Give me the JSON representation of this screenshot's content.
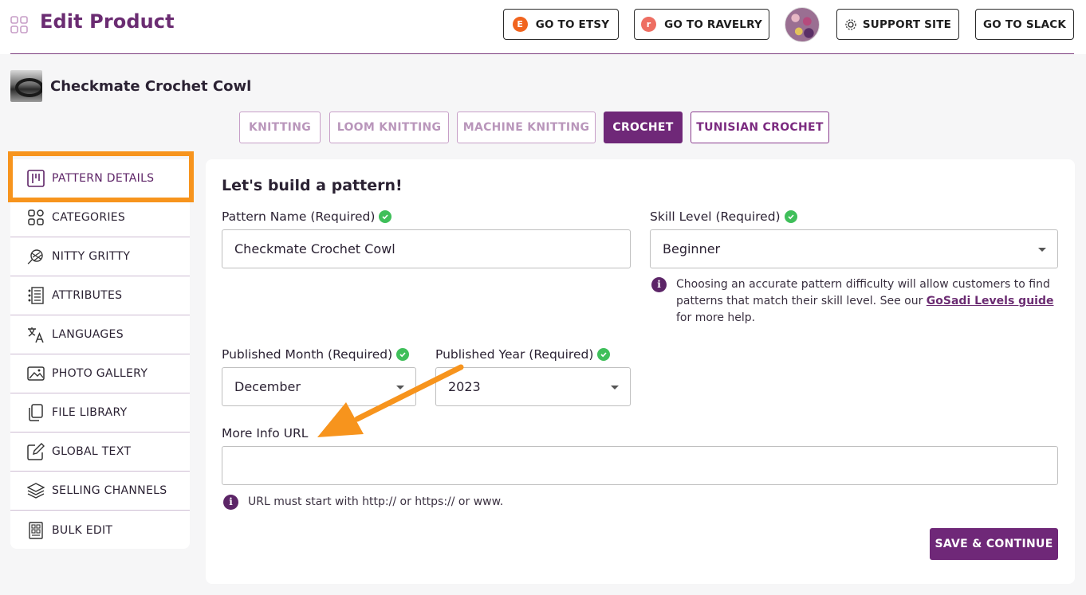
{
  "header": {
    "title": "Edit Product",
    "buttons": {
      "etsy": "GO TO ETSY",
      "ravelry": "GO TO RAVELRY",
      "support": "SUPPORT SITE",
      "slack": "GO TO SLACK"
    },
    "etsy_glyph": "E",
    "ravelry_glyph": "r",
    "etsy_color": "#f1641e",
    "ravelry_color": "#ee6e62"
  },
  "product": {
    "name": "Checkmate Crochet Cowl"
  },
  "craft_tabs": [
    "KNITTING",
    "LOOM KNITTING",
    "MACHINE KNITTING",
    "CROCHET",
    "TUNISIAN CROCHET"
  ],
  "active_craft": "CROCHET",
  "sidebar": {
    "items": [
      {
        "label": "PATTERN DETAILS",
        "icon": "pattern-icon"
      },
      {
        "label": "CATEGORIES",
        "icon": "categories-icon"
      },
      {
        "label": "NITTY GRITTY",
        "icon": "yarn-icon"
      },
      {
        "label": "ATTRIBUTES",
        "icon": "attributes-icon"
      },
      {
        "label": "LANGUAGES",
        "icon": "translate-icon"
      },
      {
        "label": "PHOTO GALLERY",
        "icon": "image-icon"
      },
      {
        "label": "FILE LIBRARY",
        "icon": "files-icon"
      },
      {
        "label": "GLOBAL TEXT",
        "icon": "edit-icon"
      },
      {
        "label": "SELLING CHANNELS",
        "icon": "layers-icon"
      },
      {
        "label": "BULK EDIT",
        "icon": "bulk-edit-icon"
      }
    ]
  },
  "form": {
    "title": "Let's build a pattern!",
    "pattern_name_label": "Pattern Name (Required)",
    "pattern_name_value": "Checkmate Crochet Cowl",
    "skill_level_label": "Skill Level (Required)",
    "skill_level_value": "Beginner",
    "skill_info_before": "Choosing an accurate pattern difficulty will allow customers to find patterns that match their skill level. See our ",
    "skill_info_link": "GoSadi Levels guide",
    "skill_info_after": " for more help.",
    "month_label": "Published Month (Required)",
    "month_value": "December",
    "year_label": "Published Year (Required)",
    "year_value": "2023",
    "url_label": "More Info URL",
    "url_value": "",
    "url_hint": "URL must start with http:// or https:// or www.",
    "save_label": "SAVE & CONTINUE"
  },
  "colors": {
    "brand_purple": "#6f2878",
    "highlight_orange": "#f7941d",
    "check_green": "#3fbf5a"
  }
}
